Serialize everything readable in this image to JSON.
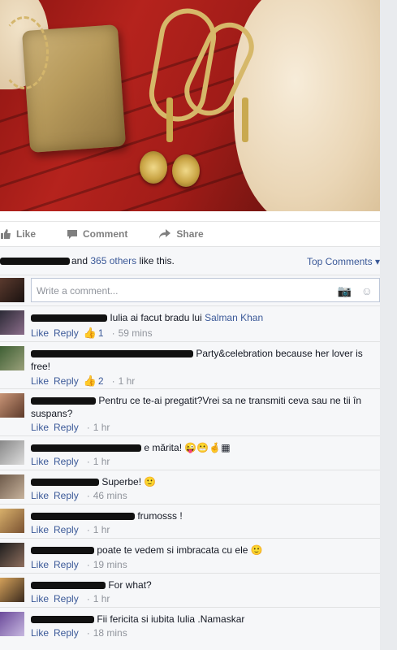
{
  "actions": {
    "like": "Like",
    "comment": "Comment",
    "share": "Share"
  },
  "likes": {
    "and": "and",
    "others": "365 others",
    "suffix": "like this.",
    "top_comments": "Top Comments ▾"
  },
  "write": {
    "placeholder": "Write a comment..."
  },
  "meta": {
    "like": "Like",
    "reply": "Reply",
    "dot": "·"
  },
  "comments": [
    {
      "text_before": "",
      "text": "Iulia ai facut bradu lui ",
      "link": "Salman Khan",
      "likes": "1",
      "time": "59 mins"
    },
    {
      "text": "Party&celebration because her lover is free!",
      "likes": "2",
      "time": "1 hr"
    },
    {
      "text": "Pentru ce te-ai pregatit?Vrei sa ne transmiti ceva sau ne tii în suspans?",
      "time": "1 hr"
    },
    {
      "text": "e mărita!",
      "time": "1 hr"
    },
    {
      "text": "Superbe!",
      "time": "46 mins"
    },
    {
      "text": "frumosss !",
      "time": "1 hr"
    },
    {
      "text": "poate te vedem si imbracata cu ele",
      "time": "19 mins"
    },
    {
      "text": "For what?",
      "time": "1 hr"
    },
    {
      "text": "Fii fericita si iubita Iulia .Namaskar",
      "time": "18 mins"
    }
  ],
  "colors": {
    "link": "#3b5998",
    "meta": "#90949c",
    "background": "#e9ebee",
    "panel": "#f6f7f9"
  }
}
